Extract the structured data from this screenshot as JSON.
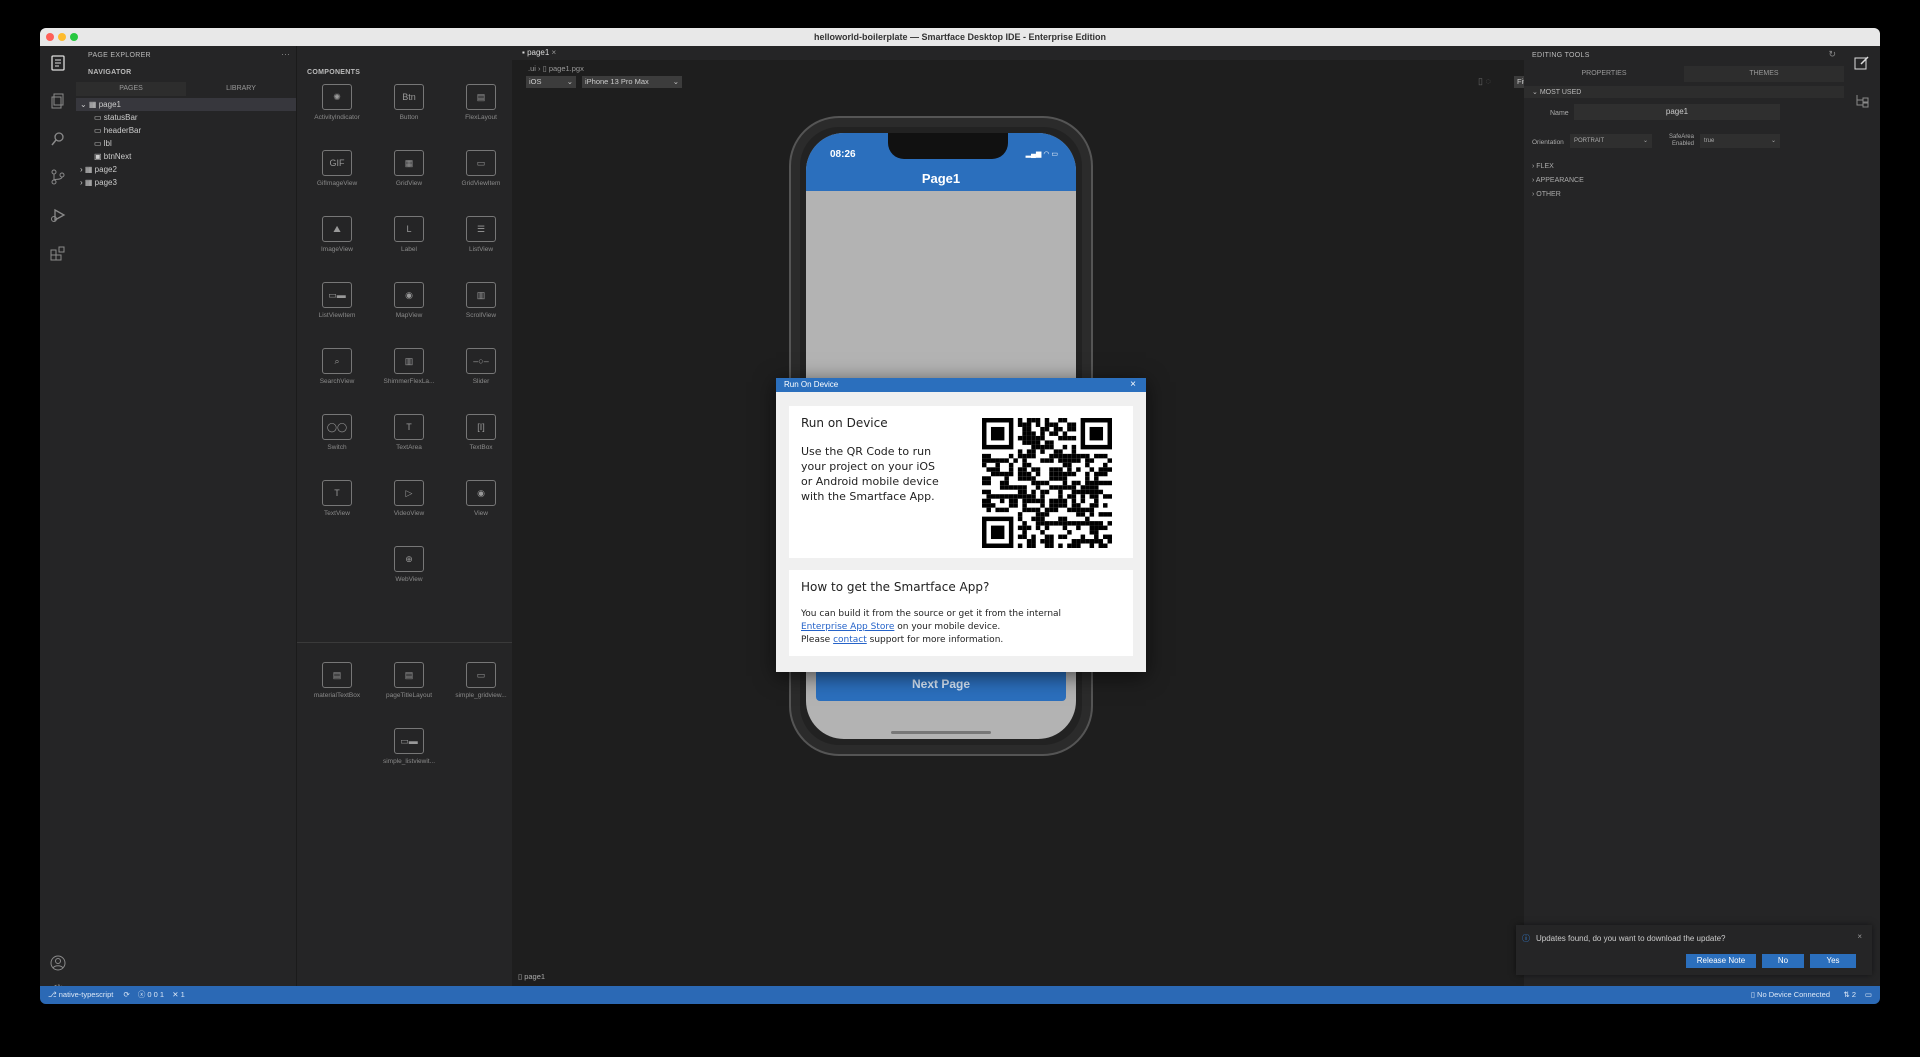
{
  "window": {
    "title": "helloworld-boilerplate — Smartface Desktop IDE - Enterprise Edition"
  },
  "page_explorer": {
    "header": "PAGE EXPLORER",
    "navigator": "NAVIGATOR",
    "tabs": [
      "PAGES",
      "LIBRARY"
    ],
    "tree": [
      {
        "label": "page1",
        "level": 0
      },
      {
        "label": "statusBar",
        "level": 1
      },
      {
        "label": "headerBar",
        "level": 1
      },
      {
        "label": "lbl",
        "level": 1
      },
      {
        "label": "btnNext",
        "level": 1
      },
      {
        "label": "page2",
        "level": 0
      },
      {
        "label": "page3",
        "level": 0
      }
    ]
  },
  "components": {
    "header": "COMPONENTS",
    "items": [
      "ActivityIndicator",
      "Button",
      "FlexLayout",
      "GifImageView",
      "GridView",
      "GridViewItem",
      "ImageView",
      "Label",
      "ListView",
      "ListViewItem",
      "MapView",
      "ScrollView",
      "SearchView",
      "ShimmerFlexLa...",
      "Slider",
      "Switch",
      "TextArea",
      "TextBox",
      "TextView",
      "VideoView",
      "View",
      "WebView"
    ],
    "library_items": [
      "materialTextBox",
      "pageTitleLayout",
      "simple_gridview...",
      "simple_listviewit..."
    ],
    "button_glyph": "Btn"
  },
  "editor": {
    "tab": "page1",
    "breadcrumb": [
      ".ui",
      "page1.pgx"
    ],
    "os_select": "iOS",
    "device_select": "iPhone 13 Pro Max",
    "zoom_select": "Fit",
    "footer_label": "page1"
  },
  "phone": {
    "time": "08:26",
    "title": "Page1",
    "next_button": "Next Page"
  },
  "dialog": {
    "title": "Run On Device",
    "close": "×",
    "card1_heading": "Run on Device",
    "card1_body": "Use the QR Code to run your project on your iOS or Android mobile device with the Smartface App.",
    "card2_heading": "How to get the Smartface App?",
    "card2_line1": "You can build it from the source or get it from the internal",
    "card2_link1": "Enterprise App Store",
    "card2_line2": " on your mobile device.",
    "card2_line3a": "Please ",
    "card2_link2": "contact",
    "card2_line3b": " support for more information."
  },
  "editing_tools": {
    "header": "EDITING TOOLS",
    "tabs": [
      "PROPERTIES",
      "THEMES"
    ],
    "most_used": "MOST USED",
    "name_label": "Name",
    "name_value": "page1",
    "orientation_label": "Orientation",
    "orientation_value": "PORTRAIT",
    "safearea_label": "SafeArea Enabled",
    "safearea_value": "true",
    "sections": [
      "FLEX",
      "APPEARANCE",
      "OTHER"
    ]
  },
  "notification": {
    "message": "Updates found, do you want to download the update?",
    "buttons": [
      "Release Note",
      "No",
      "Yes"
    ]
  },
  "statusbar": {
    "branch": "native-typescript",
    "problems": "0 0  1",
    "ports": "1",
    "device": "No Device Connected",
    "count": "2"
  },
  "colors": {
    "accent": "#2b6fbd",
    "statusbar": "#2b69b5",
    "bg": "#1e1e1e",
    "panel": "#252526"
  }
}
